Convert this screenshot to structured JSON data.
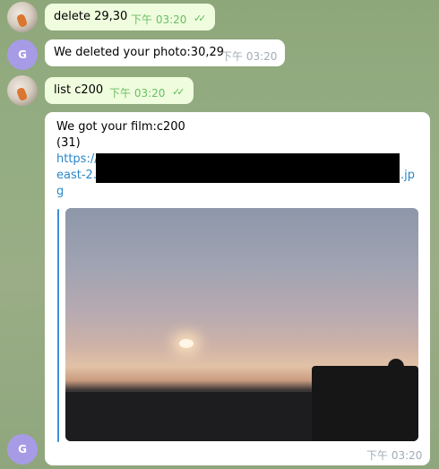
{
  "messages": [
    {
      "type": "out",
      "text": "delete 29,30",
      "time": "下午 03:20"
    },
    {
      "type": "in",
      "sender_initial": "G",
      "text": "We deleted your photo:30,29",
      "time": "下午 03:20"
    },
    {
      "type": "out",
      "text": "list c200",
      "time": "下午 03:20"
    },
    {
      "type": "in",
      "sender_initial": "G",
      "line1": "We got your film:c200",
      "line2": "(31)",
      "link_start": "https://",
      "link_mid_left": "east-2.a",
      "link_mid_right": ".jp",
      "link_end": "g",
      "time": "下午 03:20"
    }
  ],
  "colors": {
    "outgoing_bubble": "#effdde",
    "incoming_bubble": "#ffffff",
    "link": "#2a87c8",
    "check": "#5fba58",
    "avatar_letter_bg": "#a79be6"
  },
  "icons": [
    "double-check-icon"
  ]
}
